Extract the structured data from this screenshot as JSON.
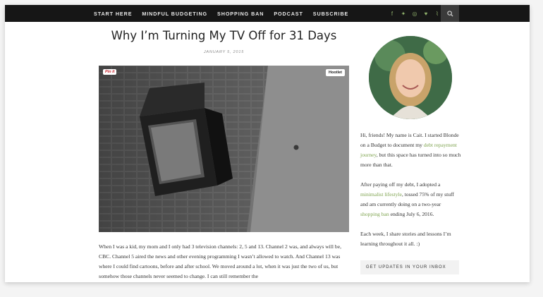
{
  "nav": {
    "items": [
      "START HERE",
      "MINDFUL BUDGETING",
      "SHOPPING BAN",
      "PODCAST",
      "SUBSCRIBE"
    ]
  },
  "social": {
    "icons": [
      "facebook-icon",
      "twitter-icon",
      "instagram-icon",
      "heart-icon",
      "rss-icon"
    ],
    "glyphs": [
      "f",
      "✦",
      "◎",
      "♥",
      "⌇"
    ],
    "color": "#8fb06b"
  },
  "search": {
    "icon": "search-icon"
  },
  "article": {
    "title": "Why I’m Turning My TV Off for 31 Days",
    "date": "JANUARY 5, 2015",
    "image_badges": {
      "pinit": "Pin it",
      "hootlet": "Hootlet"
    },
    "body": "When I was a kid, my mom and I only had 3 television channels: 2, 5 and 13. Channel 2 was, and always will be, CBC. Channel 5 aired the news and other evening programming I wasn’t allowed to watch. And Channel 13 was where I could find cartoons, before and after school. We moved around a lot, when it was just the two of us, but somehow those channels never seemed to change. I can still remember the"
  },
  "sidebar": {
    "intro_1": "Hi, friends! My name is Cait. I started Blonde on a Budget to document my ",
    "link_1": "debt repayment journey",
    "intro_2": ", but this space has turned into so much more than that.",
    "p2_a": "After paying off my debt, I adopted a ",
    "link_2": "minimalist lifestyle",
    "p2_b": ", tossed 75% of my stuff and am currently doing on a two-year ",
    "link_3": "shopping ban",
    "p2_c": " ending July 6, 2016.",
    "p3": "Each week, I share stories and lessons I’m learning throughout it all. :)",
    "newsletter": "GET UPDATES IN YOUR INBOX",
    "link_color": "#7ea34f"
  }
}
